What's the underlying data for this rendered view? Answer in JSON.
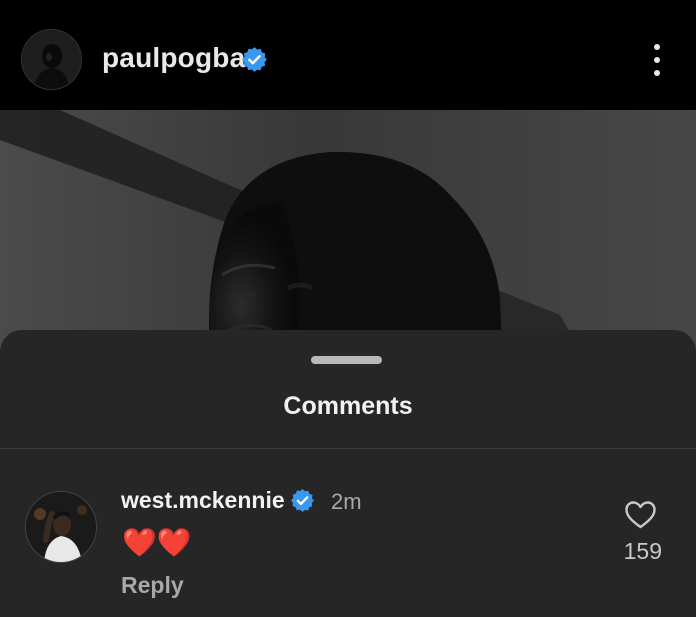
{
  "header": {
    "username": "paulpogba",
    "verified": true,
    "avatar_icon": "profile-avatar",
    "more_icon": "more-vertical-icon"
  },
  "post": {
    "image_icon": "post-photo"
  },
  "comments_sheet": {
    "title": "Comments",
    "comments": [
      {
        "author": "west.mckennie",
        "verified": true,
        "time": "2m",
        "text": "❤️❤️",
        "reply_label": "Reply",
        "like_count": "159",
        "like_icon": "heart-outline-icon"
      }
    ]
  },
  "colors": {
    "background": "#000000",
    "sheet": "#262626",
    "verified_blue": "#3897f0",
    "heart_red": "#e64040"
  }
}
